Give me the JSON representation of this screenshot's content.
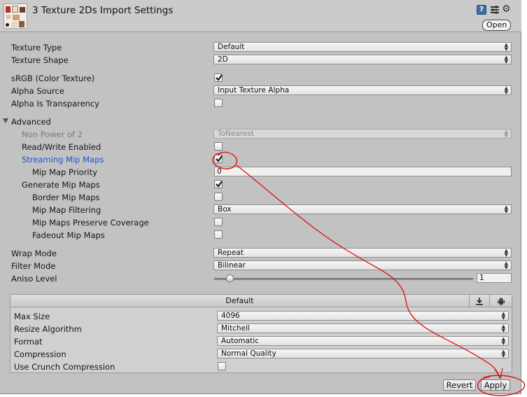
{
  "header": {
    "title": "3 Texture 2Ds Import Settings",
    "help_icon": "?",
    "open_label": "Open"
  },
  "fields": {
    "texture_type": {
      "label": "Texture Type",
      "value": "Default"
    },
    "texture_shape": {
      "label": "Texture Shape",
      "value": "2D"
    },
    "srgb": {
      "label": "sRGB (Color Texture)",
      "checked": true
    },
    "alpha_source": {
      "label": "Alpha Source",
      "value": "Input Texture Alpha"
    },
    "alpha_is_transparency": {
      "label": "Alpha Is Transparency",
      "checked": false
    },
    "advanced": {
      "label": "Advanced",
      "expanded": true
    },
    "non_power_of_2": {
      "label": "Non Power of 2",
      "value": "ToNearest",
      "disabled": true
    },
    "read_write_enabled": {
      "label": "Read/Write Enabled",
      "checked": false
    },
    "streaming_mip_maps": {
      "label": "Streaming Mip Maps",
      "checked": true
    },
    "mip_map_priority": {
      "label": "Mip Map Priority",
      "value": "0"
    },
    "generate_mip_maps": {
      "label": "Generate Mip Maps",
      "checked": true
    },
    "border_mip_maps": {
      "label": "Border Mip Maps",
      "checked": false
    },
    "mip_map_filtering": {
      "label": "Mip Map Filtering",
      "value": "Box"
    },
    "mip_maps_preserve_coverage": {
      "label": "Mip Maps Preserve Coverage",
      "checked": false
    },
    "fadeout_mip_maps": {
      "label": "Fadeout Mip Maps",
      "checked": false
    },
    "wrap_mode": {
      "label": "Wrap Mode",
      "value": "Repeat"
    },
    "filter_mode": {
      "label": "Filter Mode",
      "value": "Bilinear"
    },
    "aniso_level": {
      "label": "Aniso Level",
      "value": "1",
      "slider_fraction": 0.06
    }
  },
  "platform": {
    "tab_label": "Default",
    "download_icon": "download-icon",
    "android_icon": "android-icon",
    "max_size": {
      "label": "Max Size",
      "value": "4096"
    },
    "resize_algorithm": {
      "label": "Resize Algorithm",
      "value": "Mitchell"
    },
    "format": {
      "label": "Format",
      "value": "Automatic"
    },
    "compression": {
      "label": "Compression",
      "value": "Normal Quality"
    },
    "use_crunch_compression": {
      "label": "Use Crunch Compression",
      "checked": false
    }
  },
  "footer": {
    "revert_label": "Revert",
    "apply_label": "Apply"
  },
  "colors": {
    "panel_bg": "#c2c2c2",
    "link_label": "#1c54d6",
    "annotation": "#e01010"
  }
}
